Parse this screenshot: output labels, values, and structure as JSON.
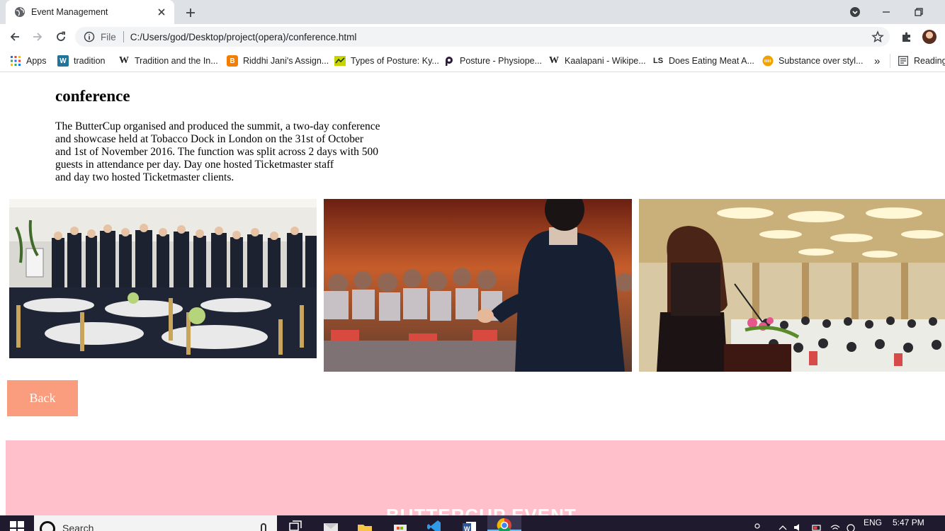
{
  "browser": {
    "tab_title": "Event Management",
    "url_protocol": "File",
    "url": "C:/Users/god/Desktop/project(opera)/conference.html",
    "new_tab_symbol": "+",
    "bookmarks": [
      {
        "label": "Apps",
        "icon": "apps-grid-icon"
      },
      {
        "label": "tradition",
        "icon": "wordpress-icon"
      },
      {
        "label": "Tradition and the In...",
        "icon": "wikipedia-icon"
      },
      {
        "label": "Riddhi Jani's Assign...",
        "icon": "blogger-icon"
      },
      {
        "label": "Types of Posture: Ky...",
        "icon": "posture-icon"
      },
      {
        "label": "Posture - Physiope...",
        "icon": "physiopedia-icon"
      },
      {
        "label": "Kaalapani - Wikipe...",
        "icon": "wikipedia-icon"
      },
      {
        "label": "Does Eating Meat A...",
        "icon": "ls-icon"
      },
      {
        "label": "Substance over styl...",
        "icon": "orange-circle-icon"
      }
    ],
    "bookmarks_overflow": "»",
    "reading_list": "Reading"
  },
  "page": {
    "heading": "conference",
    "paragraph_lines": [
      "The ButterCup organised and produced the summit, a two-day conference",
      "and showcase held at Tobacco Dock in London on the 31st of October",
      "and 1st of November 2016. The function was split across 2 days with 500",
      "guests in attendance per day. Day one hosted Ticketmaster staff",
      "and day two hosted Ticketmaster clients."
    ],
    "back_label": "Back",
    "footer_title": "BUTTERCUP EVENT"
  },
  "taskbar": {
    "search_placeholder": "Search",
    "language": "ENG",
    "time": "5:47 PM"
  },
  "colors": {
    "back_button": "#f99d7e",
    "footer_background": "#ffc0cb",
    "taskbar": "#1f1a2e"
  }
}
